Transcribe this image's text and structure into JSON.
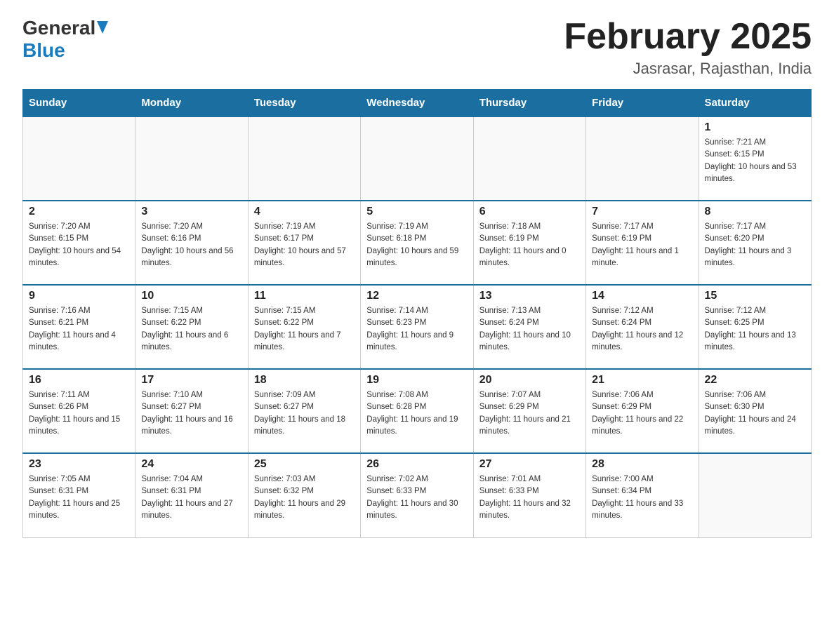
{
  "header": {
    "logo_general": "General",
    "logo_blue": "Blue",
    "title": "February 2025",
    "subtitle": "Jasrasar, Rajasthan, India"
  },
  "days_of_week": [
    "Sunday",
    "Monday",
    "Tuesday",
    "Wednesday",
    "Thursday",
    "Friday",
    "Saturday"
  ],
  "weeks": [
    [
      {
        "day": "",
        "sunrise": "",
        "sunset": "",
        "daylight": ""
      },
      {
        "day": "",
        "sunrise": "",
        "sunset": "",
        "daylight": ""
      },
      {
        "day": "",
        "sunrise": "",
        "sunset": "",
        "daylight": ""
      },
      {
        "day": "",
        "sunrise": "",
        "sunset": "",
        "daylight": ""
      },
      {
        "day": "",
        "sunrise": "",
        "sunset": "",
        "daylight": ""
      },
      {
        "day": "",
        "sunrise": "",
        "sunset": "",
        "daylight": ""
      },
      {
        "day": "1",
        "sunrise": "Sunrise: 7:21 AM",
        "sunset": "Sunset: 6:15 PM",
        "daylight": "Daylight: 10 hours and 53 minutes."
      }
    ],
    [
      {
        "day": "2",
        "sunrise": "Sunrise: 7:20 AM",
        "sunset": "Sunset: 6:15 PM",
        "daylight": "Daylight: 10 hours and 54 minutes."
      },
      {
        "day": "3",
        "sunrise": "Sunrise: 7:20 AM",
        "sunset": "Sunset: 6:16 PM",
        "daylight": "Daylight: 10 hours and 56 minutes."
      },
      {
        "day": "4",
        "sunrise": "Sunrise: 7:19 AM",
        "sunset": "Sunset: 6:17 PM",
        "daylight": "Daylight: 10 hours and 57 minutes."
      },
      {
        "day": "5",
        "sunrise": "Sunrise: 7:19 AM",
        "sunset": "Sunset: 6:18 PM",
        "daylight": "Daylight: 10 hours and 59 minutes."
      },
      {
        "day": "6",
        "sunrise": "Sunrise: 7:18 AM",
        "sunset": "Sunset: 6:19 PM",
        "daylight": "Daylight: 11 hours and 0 minutes."
      },
      {
        "day": "7",
        "sunrise": "Sunrise: 7:17 AM",
        "sunset": "Sunset: 6:19 PM",
        "daylight": "Daylight: 11 hours and 1 minute."
      },
      {
        "day": "8",
        "sunrise": "Sunrise: 7:17 AM",
        "sunset": "Sunset: 6:20 PM",
        "daylight": "Daylight: 11 hours and 3 minutes."
      }
    ],
    [
      {
        "day": "9",
        "sunrise": "Sunrise: 7:16 AM",
        "sunset": "Sunset: 6:21 PM",
        "daylight": "Daylight: 11 hours and 4 minutes."
      },
      {
        "day": "10",
        "sunrise": "Sunrise: 7:15 AM",
        "sunset": "Sunset: 6:22 PM",
        "daylight": "Daylight: 11 hours and 6 minutes."
      },
      {
        "day": "11",
        "sunrise": "Sunrise: 7:15 AM",
        "sunset": "Sunset: 6:22 PM",
        "daylight": "Daylight: 11 hours and 7 minutes."
      },
      {
        "day": "12",
        "sunrise": "Sunrise: 7:14 AM",
        "sunset": "Sunset: 6:23 PM",
        "daylight": "Daylight: 11 hours and 9 minutes."
      },
      {
        "day": "13",
        "sunrise": "Sunrise: 7:13 AM",
        "sunset": "Sunset: 6:24 PM",
        "daylight": "Daylight: 11 hours and 10 minutes."
      },
      {
        "day": "14",
        "sunrise": "Sunrise: 7:12 AM",
        "sunset": "Sunset: 6:24 PM",
        "daylight": "Daylight: 11 hours and 12 minutes."
      },
      {
        "day": "15",
        "sunrise": "Sunrise: 7:12 AM",
        "sunset": "Sunset: 6:25 PM",
        "daylight": "Daylight: 11 hours and 13 minutes."
      }
    ],
    [
      {
        "day": "16",
        "sunrise": "Sunrise: 7:11 AM",
        "sunset": "Sunset: 6:26 PM",
        "daylight": "Daylight: 11 hours and 15 minutes."
      },
      {
        "day": "17",
        "sunrise": "Sunrise: 7:10 AM",
        "sunset": "Sunset: 6:27 PM",
        "daylight": "Daylight: 11 hours and 16 minutes."
      },
      {
        "day": "18",
        "sunrise": "Sunrise: 7:09 AM",
        "sunset": "Sunset: 6:27 PM",
        "daylight": "Daylight: 11 hours and 18 minutes."
      },
      {
        "day": "19",
        "sunrise": "Sunrise: 7:08 AM",
        "sunset": "Sunset: 6:28 PM",
        "daylight": "Daylight: 11 hours and 19 minutes."
      },
      {
        "day": "20",
        "sunrise": "Sunrise: 7:07 AM",
        "sunset": "Sunset: 6:29 PM",
        "daylight": "Daylight: 11 hours and 21 minutes."
      },
      {
        "day": "21",
        "sunrise": "Sunrise: 7:06 AM",
        "sunset": "Sunset: 6:29 PM",
        "daylight": "Daylight: 11 hours and 22 minutes."
      },
      {
        "day": "22",
        "sunrise": "Sunrise: 7:06 AM",
        "sunset": "Sunset: 6:30 PM",
        "daylight": "Daylight: 11 hours and 24 minutes."
      }
    ],
    [
      {
        "day": "23",
        "sunrise": "Sunrise: 7:05 AM",
        "sunset": "Sunset: 6:31 PM",
        "daylight": "Daylight: 11 hours and 25 minutes."
      },
      {
        "day": "24",
        "sunrise": "Sunrise: 7:04 AM",
        "sunset": "Sunset: 6:31 PM",
        "daylight": "Daylight: 11 hours and 27 minutes."
      },
      {
        "day": "25",
        "sunrise": "Sunrise: 7:03 AM",
        "sunset": "Sunset: 6:32 PM",
        "daylight": "Daylight: 11 hours and 29 minutes."
      },
      {
        "day": "26",
        "sunrise": "Sunrise: 7:02 AM",
        "sunset": "Sunset: 6:33 PM",
        "daylight": "Daylight: 11 hours and 30 minutes."
      },
      {
        "day": "27",
        "sunrise": "Sunrise: 7:01 AM",
        "sunset": "Sunset: 6:33 PM",
        "daylight": "Daylight: 11 hours and 32 minutes."
      },
      {
        "day": "28",
        "sunrise": "Sunrise: 7:00 AM",
        "sunset": "Sunset: 6:34 PM",
        "daylight": "Daylight: 11 hours and 33 minutes."
      },
      {
        "day": "",
        "sunrise": "",
        "sunset": "",
        "daylight": ""
      }
    ]
  ]
}
